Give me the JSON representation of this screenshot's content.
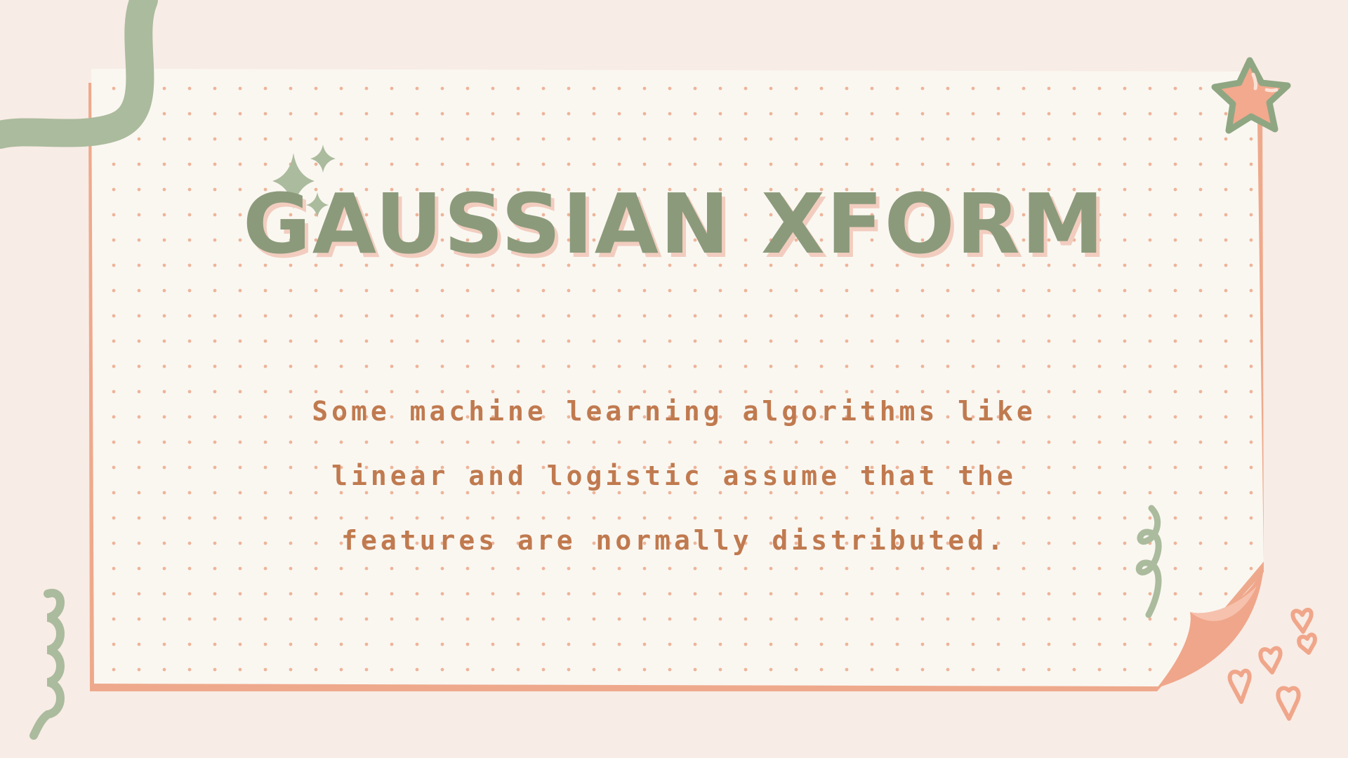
{
  "slide": {
    "title": "GAUSSIAN XFORM",
    "body": "Some machine learning algorithms like linear and logistic assume that the features are normally distributed."
  },
  "colors": {
    "background": "#f8ece6",
    "paper": "#faf7f1",
    "paper_edge": "#eea98c",
    "dot": "#eeb49a",
    "title": "#8b9a7b",
    "title_shadow": "#f2cdbf",
    "body_text": "#c07a4f",
    "sage": "#abbb9d",
    "coral": "#f0a68a"
  },
  "decorations": [
    "sage-wave-ribbon",
    "sparkle-icon",
    "star-icon",
    "squiggle-icon",
    "heart-icon",
    "page-curl"
  ]
}
